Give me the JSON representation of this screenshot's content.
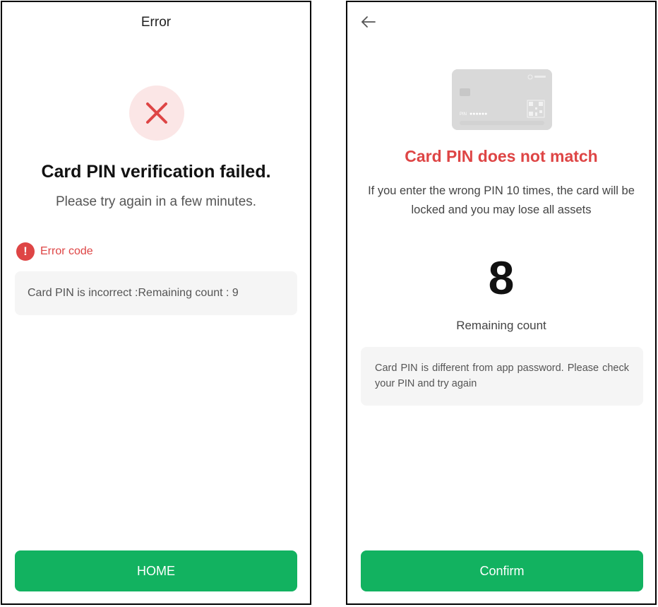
{
  "left_screen": {
    "title": "Error",
    "headline": "Card PIN verification failed.",
    "subline": "Please try again in a few minutes.",
    "error_code_label": "Error code",
    "error_message": "Card PIN is incorrect :Remaining count : 9",
    "home_button": "HOME"
  },
  "right_screen": {
    "headline": "Card PIN does not match",
    "description": "If you enter the wrong PIN 10 times, the card will be locked and you may lose all assets",
    "remaining_number": "8",
    "remaining_label": "Remaining count",
    "info_text": "Card PIN is different from app password. Please check your PIN and try again",
    "confirm_button": "Confirm",
    "card": {
      "pin_label": "PIN",
      "pin_mask": "●●●●●●"
    }
  },
  "colors": {
    "accent_green": "#12b260",
    "error_red": "#de4545",
    "error_bg": "#fbe6e6",
    "box_bg": "#f5f5f5"
  },
  "icons": [
    "close-x-icon",
    "alert-circle-icon",
    "back-arrow-icon",
    "card-chip-icon",
    "qr-code-icon"
  ]
}
